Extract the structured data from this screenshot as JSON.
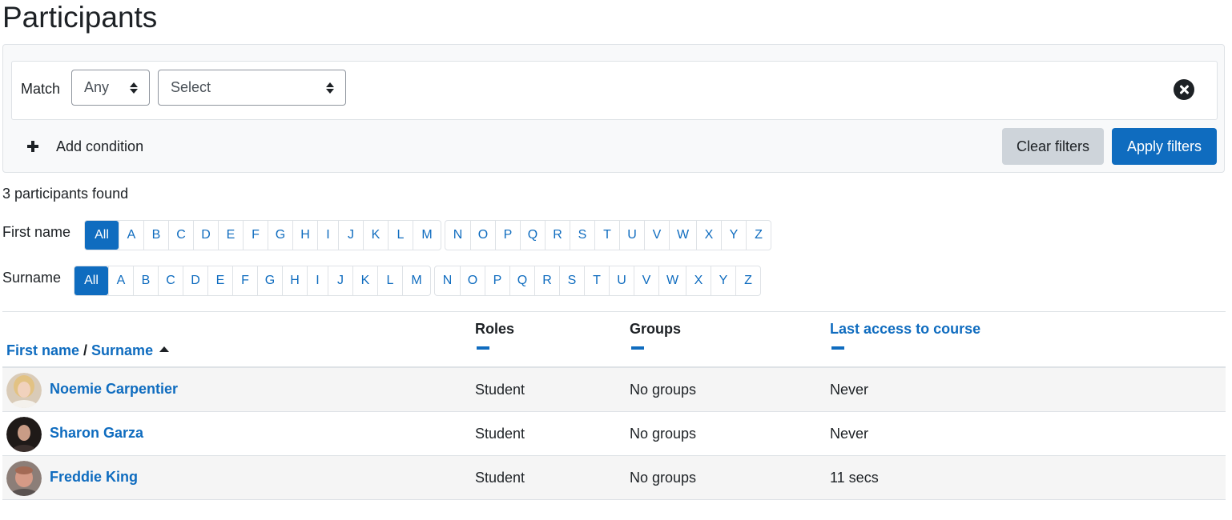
{
  "page": {
    "title": "Participants"
  },
  "filter": {
    "match_label": "Match",
    "match_value": "Any",
    "type_placeholder": "Select",
    "add_condition": "Add condition",
    "clear_label": "Clear filters",
    "apply_label": "Apply filters"
  },
  "summary": {
    "found": "3 participants found"
  },
  "initials": {
    "firstname_label": "First name",
    "surname_label": "Surname",
    "all_label": "All",
    "letters_a": [
      "A",
      "B",
      "C",
      "D",
      "E",
      "F",
      "G",
      "H",
      "I",
      "J",
      "K",
      "L",
      "M"
    ],
    "letters_b": [
      "N",
      "O",
      "P",
      "Q",
      "R",
      "S",
      "T",
      "U",
      "V",
      "W",
      "X",
      "Y",
      "Z"
    ]
  },
  "table": {
    "col_firstname": "First name",
    "col_sep": " / ",
    "col_surname": "Surname",
    "col_roles": "Roles",
    "col_groups": "Groups",
    "col_lastaccess": "Last access to course",
    "rows": [
      {
        "name": "Noemie Carpentier",
        "role": "Student",
        "groups": "No groups",
        "last_access": "Never"
      },
      {
        "name": "Sharon Garza",
        "role": "Student",
        "groups": "No groups",
        "last_access": "Never"
      },
      {
        "name": "Freddie King",
        "role": "Student",
        "groups": "No groups",
        "last_access": "11 secs"
      }
    ]
  },
  "colors": {
    "primary": "#0f6cbf",
    "secondary": "#ced4da",
    "text": "#1d2125"
  }
}
